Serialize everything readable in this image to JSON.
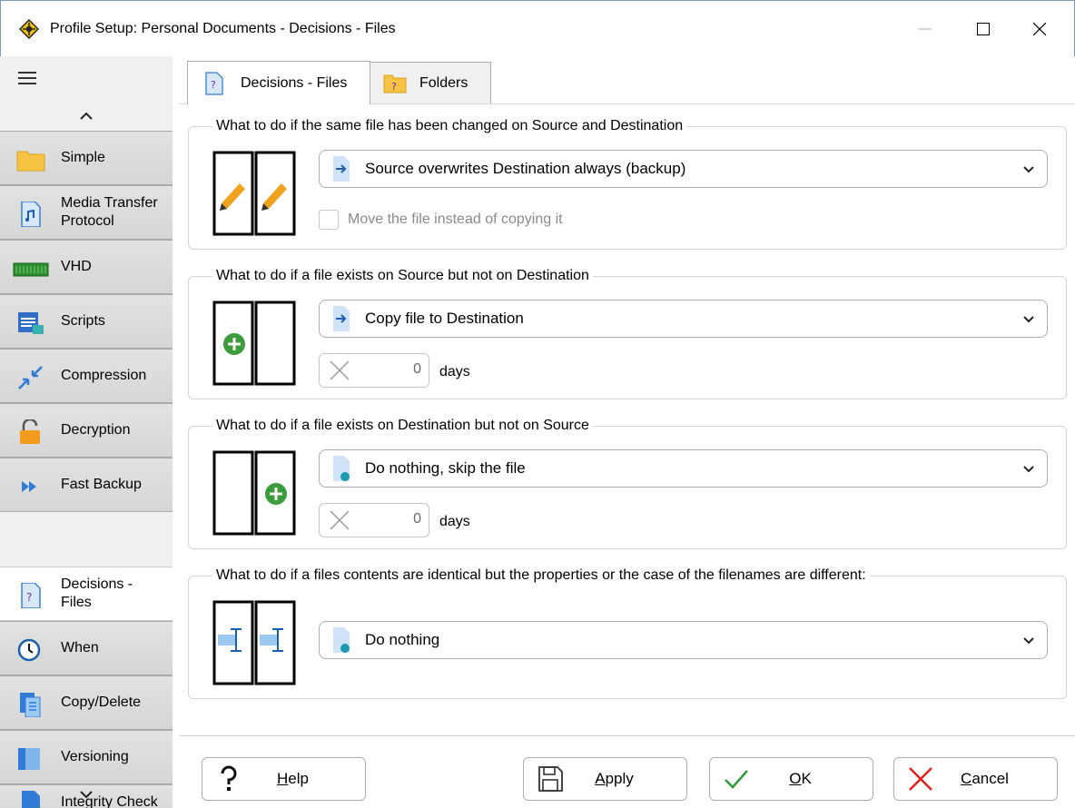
{
  "window": {
    "title": "Profile Setup: Personal Documents - Decisions - Files"
  },
  "sidebar": {
    "items": [
      {
        "label": "Simple",
        "icon": "folder-icon"
      },
      {
        "label": "Media Transfer Protocol",
        "icon": "media-file-icon"
      },
      {
        "label": "VHD",
        "icon": "vhd-icon"
      },
      {
        "label": "Scripts",
        "icon": "scripts-icon"
      },
      {
        "label": "Compression",
        "icon": "compression-icon"
      },
      {
        "label": "Decryption",
        "icon": "unlock-icon"
      },
      {
        "label": "Fast Backup",
        "icon": "fast-forward-icon"
      },
      {
        "label": "Decisions - Files",
        "icon": "decision-file-icon",
        "active": true
      },
      {
        "label": "When",
        "icon": "clock-icon"
      },
      {
        "label": "Copy/Delete",
        "icon": "copy-delete-icon"
      },
      {
        "label": "Versioning",
        "icon": "versioning-icon"
      },
      {
        "label": "Integrity Check",
        "icon": "integrity-check-icon"
      }
    ]
  },
  "tabs": [
    {
      "label": "Decisions - Files",
      "active": true
    },
    {
      "label": "Folders",
      "active": false
    }
  ],
  "groups": {
    "changed_both": {
      "label": "What to do if the same file has been changed on Source and Destination",
      "selected": "Source overwrites Destination always (backup)",
      "checkbox_label": "Move the file instead of copying it",
      "checked": false
    },
    "source_only": {
      "label": "What to do if a file exists on Source but not on Destination",
      "selected": "Copy file to Destination",
      "days_value": "0",
      "days_label": "days"
    },
    "dest_only": {
      "label": "What to do if a file exists on Destination but not on Source",
      "selected": "Do nothing, skip the file",
      "days_value": "0",
      "days_label": "days"
    },
    "identical": {
      "label": "What to do if a files contents are identical but the properties or the case of the filenames are different:",
      "selected": "Do nothing"
    }
  },
  "buttons": {
    "help_accel": "H",
    "help_rest": "elp",
    "apply_accel": "A",
    "apply_rest": "pply",
    "ok_accel": "O",
    "ok_rest": "K",
    "cancel_accel": "C",
    "cancel_rest": "ancel"
  },
  "colors": {
    "accent_blue": "#2f7bd6",
    "pencil_orange": "#f0a21d",
    "green_plus": "#3a9c3a",
    "cancel_red": "#e0201b",
    "ok_green": "#2e9b3a"
  }
}
